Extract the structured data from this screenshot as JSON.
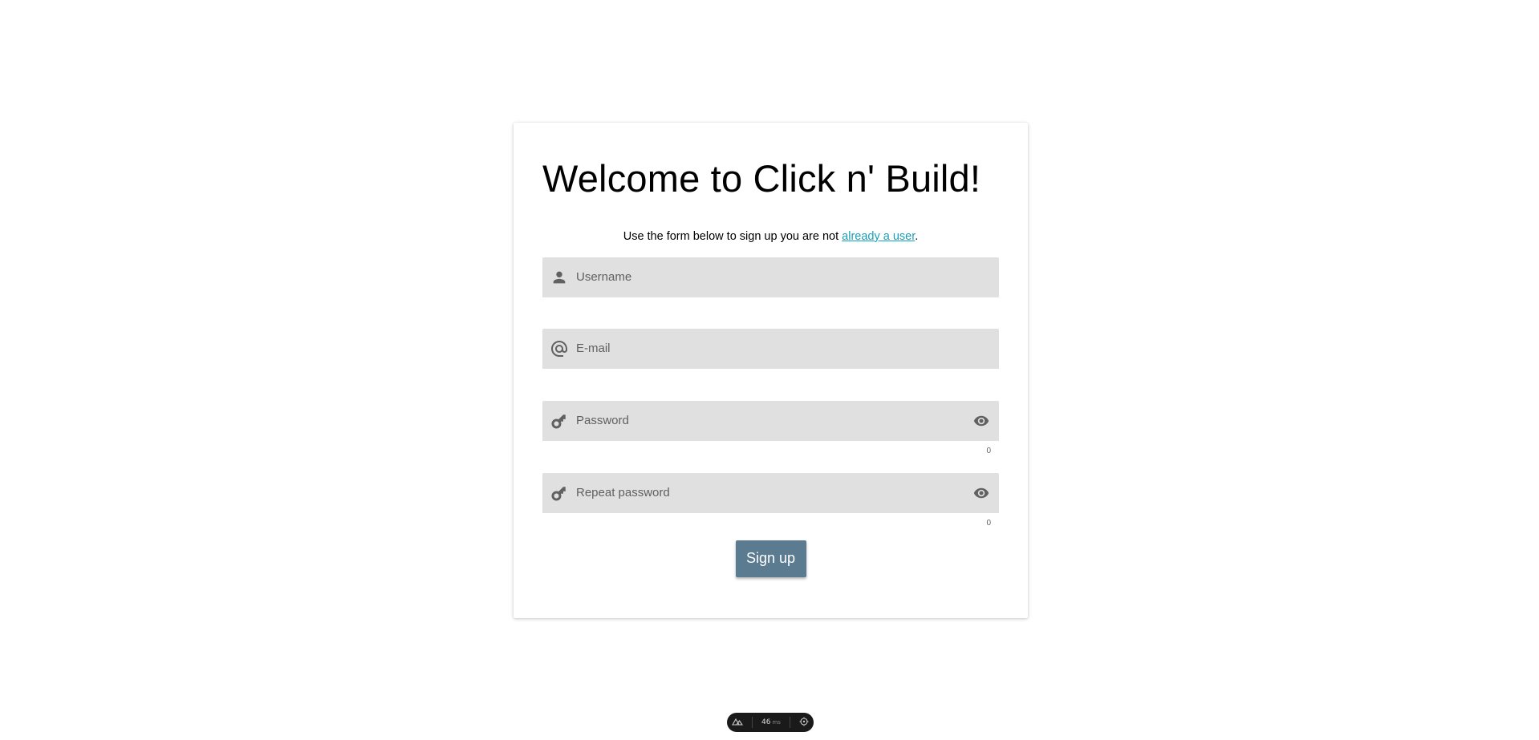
{
  "page": {
    "title": "Welcome to Click n' Build!",
    "subtitle_prefix": "Use the form below to sign up you are not ",
    "subtitle_link": "already a user",
    "subtitle_suffix": "."
  },
  "form": {
    "username": {
      "placeholder": "Username",
      "value": "",
      "icon": "person-icon"
    },
    "email": {
      "placeholder": "E-mail",
      "value": "",
      "icon": "at-icon"
    },
    "password": {
      "placeholder": "Password",
      "value": "",
      "icon": "key-icon",
      "counter": "0",
      "toggle_icon": "eye-icon"
    },
    "repeat_password": {
      "placeholder": "Repeat password",
      "value": "",
      "icon": "key-icon",
      "counter": "0",
      "toggle_icon": "eye-icon"
    },
    "submit_label": "Sign up"
  },
  "devbar": {
    "time_value": "46",
    "time_unit": "ms"
  },
  "colors": {
    "button": "#5b7b91",
    "link": "#17a2b8",
    "field_bg": "#e0e0e0",
    "icon": "#616161"
  }
}
